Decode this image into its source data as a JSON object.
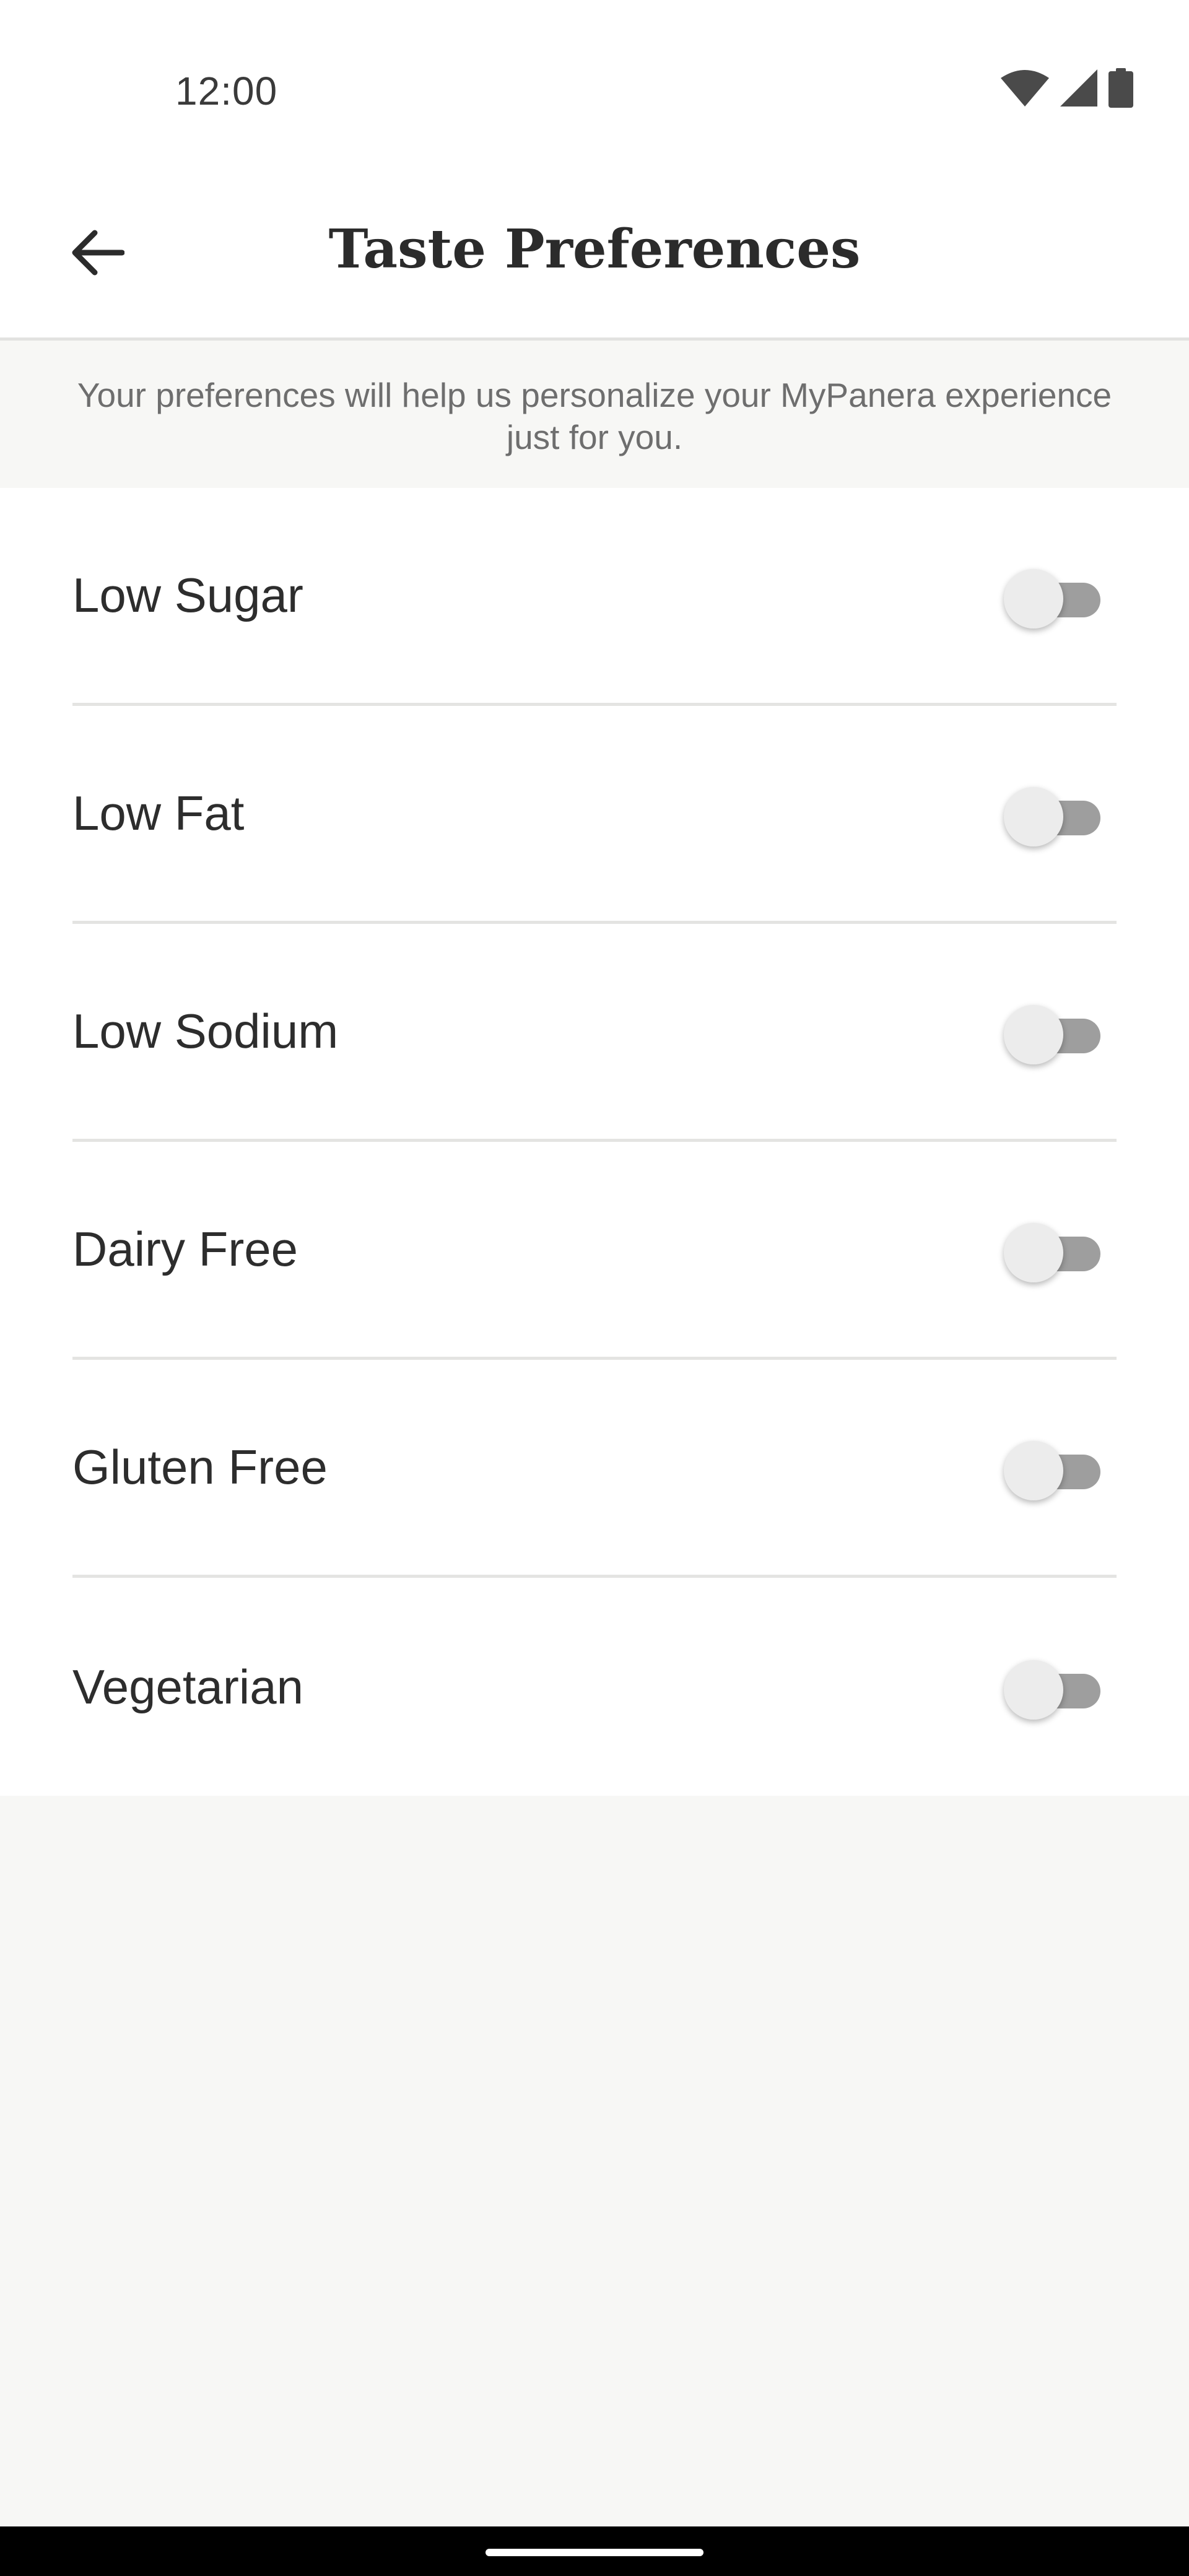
{
  "status_bar": {
    "time": "12:00",
    "icons": [
      "wifi-icon",
      "cellular-signal-icon",
      "battery-icon"
    ]
  },
  "header": {
    "back_icon": "arrow-left-icon",
    "title": "Taste Preferences"
  },
  "description": "Your preferences will help us personalize your MyPanera experience just for you.",
  "preferences": [
    {
      "label": "Low Sugar",
      "enabled": false
    },
    {
      "label": "Low Fat",
      "enabled": false
    },
    {
      "label": "Low Sodium",
      "enabled": false
    },
    {
      "label": "Dairy Free",
      "enabled": false
    },
    {
      "label": "Gluten Free",
      "enabled": false
    },
    {
      "label": "Vegetarian",
      "enabled": false
    }
  ],
  "colors": {
    "background": "#f7f7f5",
    "surface": "#ffffff",
    "text_primary": "#2d2d2d",
    "text_secondary": "#6e6e6e",
    "toggle_track_off": "#9e9e9e",
    "toggle_thumb_off": "#ececec"
  }
}
